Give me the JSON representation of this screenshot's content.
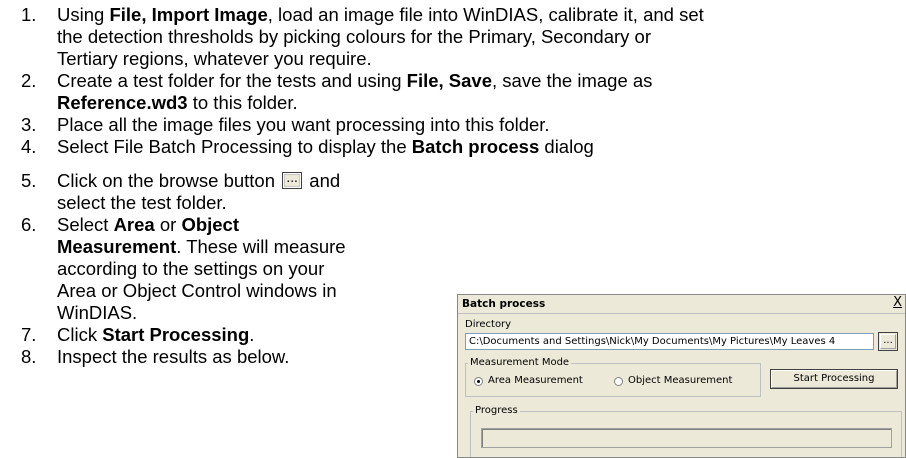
{
  "steps": [
    {
      "num": "1.",
      "line1_pre": "Using ",
      "line1_bold": "File, Import Image",
      "line1_post": ", load an image file into WinDIAS, calibrate it, and set",
      "line2": "the detection thresholds by picking colours for the Primary, Secondary or",
      "line3": "Tertiary regions, whatever you require."
    },
    {
      "num": "2.",
      "line1_pre": "Create a test folder for the tests and using ",
      "line1_bold": "File, Save",
      "line1_post": ", save the image as",
      "line2_bold": "Reference.wd3",
      "line2_post": " to this folder."
    },
    {
      "num": "3.",
      "text": "Place all the image files you want processing into this folder."
    },
    {
      "num": "4.",
      "pre": "Select File Batch Processing to display the ",
      "bold": "Batch process",
      "post": " dialog"
    },
    {
      "num": "5.",
      "line1_pre": "Click on the browse button ",
      "line1_post": " and",
      "line2": "select the test folder."
    },
    {
      "num": "6.",
      "line1_pre": "Select ",
      "line1_bold1": "Area",
      "line1_mid": " or ",
      "line1_bold2": "Object",
      "line2_bold": "Measurement",
      "line2_post": ". These will measure",
      "line3": "according to the settings on your",
      "line4": "Area or Object Control windows in",
      "line5": "WinDIAS."
    },
    {
      "num": "7.",
      "pre": "Click ",
      "bold": "Start Processing",
      "post": "."
    },
    {
      "num": "8.",
      "text": "Inspect the results as below."
    }
  ],
  "browse_glyph": "...",
  "dialog": {
    "title": "Batch process",
    "close": "X",
    "directory_label": "Directory",
    "directory_value": "C:\\Documents and Settings\\Nick\\My Documents\\My Pictures\\My Leaves 4",
    "browse_label": "...",
    "mode_label": "Measurement Mode",
    "area_label": "Area Measurement",
    "object_label": "Object Measurement",
    "selected_mode": "area",
    "start_label": "Start Processing",
    "progress_label": "Progress"
  }
}
